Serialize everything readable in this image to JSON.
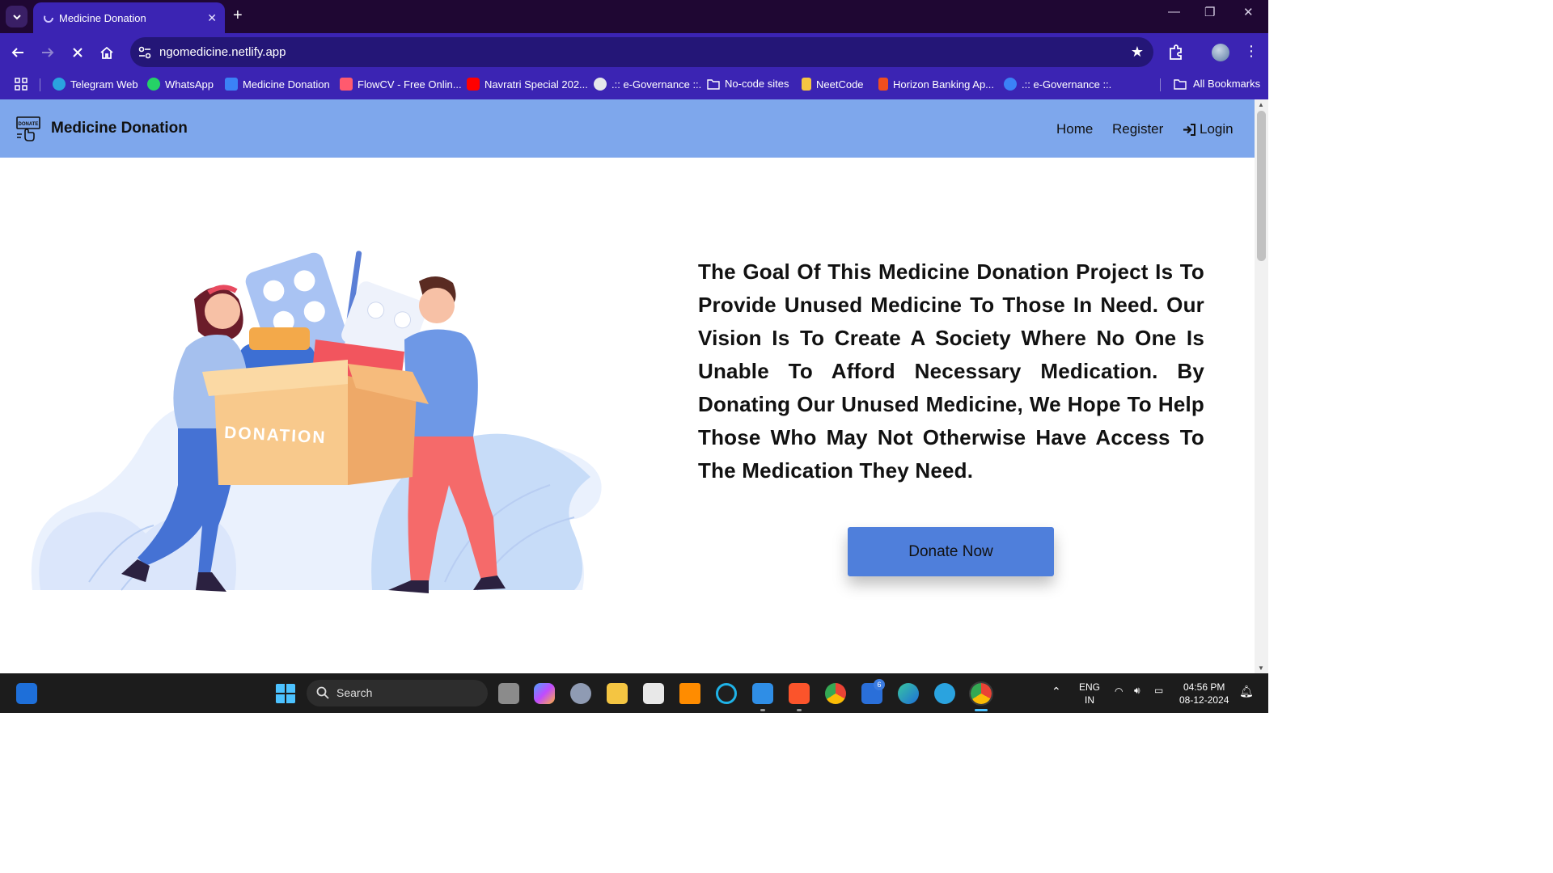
{
  "browser": {
    "tab_title": "Medicine Donation",
    "new_tab": "+",
    "close_tab": "✕",
    "url": "ngomedicine.netlify.app",
    "window_controls": {
      "minimize": "—",
      "restore": "❐",
      "close": "✕"
    }
  },
  "bookmarks": {
    "items": [
      {
        "label": "Telegram Web",
        "color": "#2aa3df"
      },
      {
        "label": "WhatsApp",
        "color": "#25d366"
      },
      {
        "label": "Medicine Donation",
        "color": "#3b82f6"
      },
      {
        "label": "FlowCV - Free Onlin...",
        "color": "#ff5a6e"
      },
      {
        "label": "Navratri Special 202...",
        "color": "#ff0000"
      },
      {
        "label": ".:: e-Governance ::.",
        "color": "#e5e7eb"
      },
      {
        "label": "No-code sites",
        "color": "folder"
      },
      {
        "label": "NeetCode",
        "color": "#f5c542"
      },
      {
        "label": "Horizon Banking Ap...",
        "color": "#f24e1e"
      },
      {
        "label": ".:: e-Governance ::.",
        "color": "#3b82f6"
      }
    ],
    "all_bookmarks": "All Bookmarks"
  },
  "site": {
    "brand": "Medicine Donation",
    "nav": {
      "home": "Home",
      "register": "Register",
      "login": "Login"
    },
    "mission": "The Goal Of This Medicine Donation Project Is To Provide Unused Medicine To Those In Need. Our Vision Is To Create A Society Where No One Is Unable To Afford Necessary Medication. By Donating Our Unused Medicine, We Hope To Help Those Who May Not Otherwise Have Access To The Medication They Need.",
    "donate_button": "Donate Now",
    "illustration_box_text": "DONATION"
  },
  "taskbar": {
    "search_placeholder": "Search",
    "lang_top": "ENG",
    "lang_bottom": "IN",
    "time": "04:56 PM",
    "date": "08-12-2024",
    "mail_badge": "6"
  },
  "colors": {
    "tab_bar": "#1f0733",
    "browser_chrome": "#3b24b3",
    "site_nav": "#7ea7ec",
    "donate_button": "#4f7fdb",
    "taskbar": "#1c1c1c"
  }
}
